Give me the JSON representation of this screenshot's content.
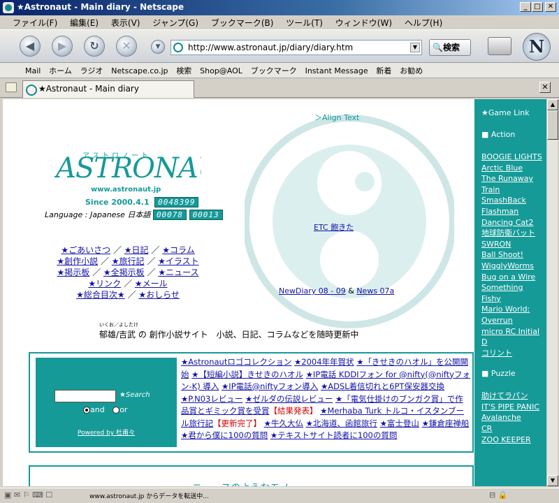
{
  "window": {
    "title": "★Astronaut - Main diary - Netscape"
  },
  "menu": [
    "ファイル(F)",
    "編集(E)",
    "表示(V)",
    "ジャンプ(G)",
    "ブックマーク(B)",
    "ツール(T)",
    "ウィンドウ(W)",
    "ヘルプ(H)"
  ],
  "navbar": {
    "url": "http://www.astronaut.jp/diary/diary.htm",
    "search_label": "検索"
  },
  "personal_bar": [
    "Mail",
    "ホーム",
    "ラジオ",
    "Netscape.co.jp",
    "検索",
    "Shop@AOL",
    "ブックマーク",
    "Instant Message",
    "新着",
    "お勧め"
  ],
  "tab": {
    "title": "★Astronaut - Main diary"
  },
  "page": {
    "align_text": "＞Align Text",
    "etc_link": "ETC 飽きた",
    "newdiary_link": "NewDiary 08 - 09",
    "amp": "&",
    "news_link": "News 07a",
    "logo_text": "ASTRONAUT",
    "logo_kana": "アストロノート",
    "logo_url": "www.astronaut.jp",
    "since": "Since 2000.4.1",
    "counter_total": "0048399",
    "language": "Language : Japanese 日本語",
    "counter_today": "00078",
    "counter_yesterday": "00013",
    "nav_rows": [
      [
        "★ごあいさつ",
        "★日記",
        "★コラム"
      ],
      [
        "★創作小説",
        "★旅行記",
        "★イラスト"
      ],
      [
        "★掲示板",
        "★全掲示板",
        "★ニュース"
      ],
      [
        "★リンク",
        "★メール"
      ],
      [
        "★総合目次★",
        "★おしらせ"
      ]
    ],
    "ruby": "いくお／よしたけ",
    "tagline": "郁雄/吉武 の 創作小説サイト　小説、日記、コラムなどを随時更新中",
    "search": {
      "button": "★Search",
      "and": "and",
      "or": "or",
      "powered": "Powered by 杜甫々"
    },
    "news_items": [
      "★Astronautロゴコレクション",
      "★2004年年賀状",
      "★「きせきのハオル」を公開開始",
      "★【短編小説】きせきのハオル",
      "★IP電話 KDDIフォン for @nifty(@niftyフォン-K) 導入",
      "★IP電話@niftyフォン導入",
      "★ADSL着信切れと6PT保安器交換",
      "★P.N03レビュー",
      "★ゼルダの伝説レビュー",
      "★「電気仕掛けのブンガク賞」で作品賞とギミック賞を受賞",
      "【結果発表】",
      "★Merhaba Turk トルコ・イスタンブール旅行記",
      "【更新完了】",
      "★牛久大仏",
      "★北海道、函館旅行",
      "★富士登山",
      "★鎌倉座禅船",
      "★君から僕に100の質問",
      "★テキストサイト読者に100の質問"
    ],
    "bottom_title": "ニュースのようなモノ"
  },
  "sidebar": {
    "game_link": "★Game Link",
    "action": "■ Action",
    "action_links": [
      "BOOGIE LIGHTS",
      "Arctic Blue",
      "The Runaway Train",
      "SmashBack",
      "Flashman",
      "Dancing Cat2",
      "地球防衛バット",
      "SWRON",
      "Ball Shoot!",
      "WigglyWorms",
      "Bug on a Wire",
      "Something Fishy",
      "Mario World: Overrun",
      "micro RC Initial D",
      "コリント"
    ],
    "puzzle": "■ Puzzle",
    "puzzle_links": [
      "助けてラパン",
      "IT'S PIPE PANIC",
      "Avalanche",
      "CR",
      "ZOO KEEPER"
    ]
  },
  "status": {
    "text": "www.astronaut.jp からデータを転送中..."
  },
  "colors": {
    "teal": "#159a98",
    "link": "#1212a8",
    "titlebar": "#0a246a"
  }
}
